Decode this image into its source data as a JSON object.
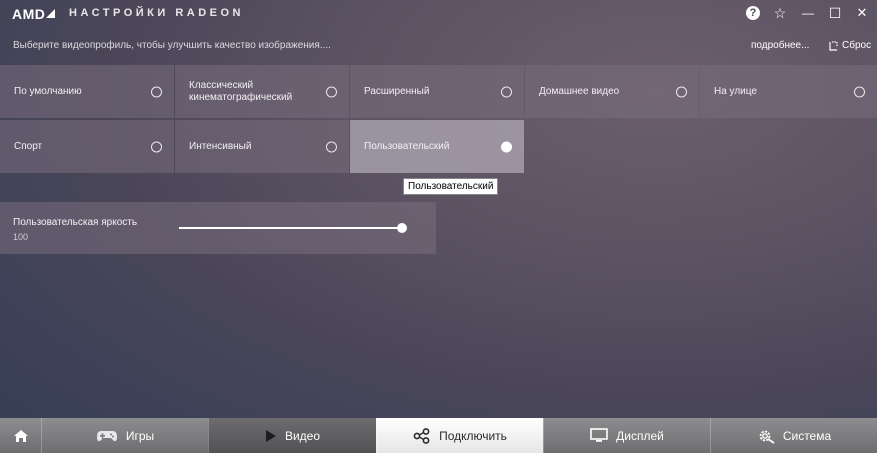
{
  "app": {
    "brand": "AMD",
    "title": "НАСТРОЙКИ RADEON"
  },
  "window_controls": {
    "help_label": "?",
    "pin_label": "☆",
    "minimize_label": "—",
    "maximize_label": "☐",
    "close_label": "✕"
  },
  "header": {
    "subtitle": "Выберите видеопрофиль, чтобы улучшить качество изображения....",
    "more_label": "подробнее...",
    "reset_label": "Сброс"
  },
  "profiles": [
    {
      "label": "По умолчанию",
      "selected": false
    },
    {
      "label": "Классический кинематографический",
      "selected": false
    },
    {
      "label": "Расширенный",
      "selected": false
    },
    {
      "label": "Домашнее видео",
      "selected": false
    },
    {
      "label": "На улице",
      "selected": false
    },
    {
      "label": "Спорт",
      "selected": false
    },
    {
      "label": "Интенсивный",
      "selected": false
    },
    {
      "label": "Пользовательский",
      "selected": true
    }
  ],
  "tooltip": "Пользовательский",
  "brightness": {
    "label": "Пользовательская яркость",
    "value": "100",
    "level": 1.0
  },
  "nav": {
    "games": "Игры",
    "video": "Видео",
    "connect": "Подключить",
    "display": "Дисплей",
    "system": "Система"
  }
}
